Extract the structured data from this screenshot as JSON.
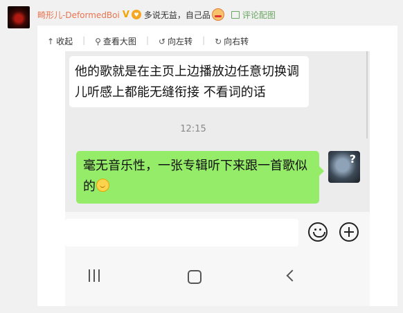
{
  "post": {
    "username": "畸形儿-DeformedBoi",
    "verified_badge": "V",
    "text": "多说无益，自己品",
    "pic_link": "评论配图"
  },
  "toolbar": {
    "collapse": "收起",
    "view_large": "查看大图",
    "rotate_left": "向左转",
    "rotate_right": "向右转"
  },
  "chat": {
    "received_message": "他的歌就是在主页上边播放边任意切换调儿听感上都能无缝衔接 不看词的话",
    "timestamp": "12:15",
    "sent_message": "毫无音乐性，一张专辑听下来跟一首歌似的",
    "bubble_received_color": "#ffffff",
    "bubble_sent_color": "#95ec69"
  },
  "icons": {
    "collapse": "arrow-up-icon",
    "view_large": "magnifier-icon",
    "rotate_left": "rotate-left-icon",
    "rotate_right": "rotate-right-icon",
    "emoji": "emoji-icon",
    "add": "plus-icon",
    "nav_recent": "recent-apps-icon",
    "nav_home": "home-icon",
    "nav_back": "back-icon"
  }
}
